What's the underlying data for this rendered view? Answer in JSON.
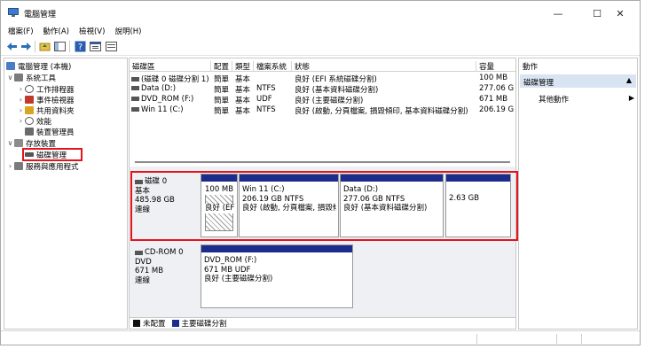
{
  "window": {
    "title": "電腦管理"
  },
  "window_buttons": {
    "minimize": "—",
    "maximize": "☐",
    "close": "✕"
  },
  "menu": [
    "檔案(F)",
    "動作(A)",
    "檢視(V)",
    "說明(H)"
  ],
  "tree": {
    "root": "電腦管理 (本機)",
    "system_tools": "系統工具",
    "task_scheduler": "工作排程器",
    "event_viewer": "事件檢視器",
    "shared_folders": "共用資料夾",
    "performance": "效能",
    "device_manager": "裝置管理員",
    "storage": "存放裝置",
    "disk_management": "磁碟管理",
    "services": "服務與應用程式"
  },
  "volume_table": {
    "headers": [
      "磁碟區",
      "配置",
      "類型",
      "檔案系統",
      "狀態",
      "容量"
    ],
    "rows": [
      {
        "volume": "(磁碟 0 磁碟分割 1)",
        "layout": "簡單",
        "type": "基本",
        "fs": "",
        "status": "良好 (EFI 系統磁碟分割)",
        "capacity": "100 MB"
      },
      {
        "volume": "Data (D:)",
        "layout": "簡單",
        "type": "基本",
        "fs": "NTFS",
        "status": "良好 (基本資料磁碟分割)",
        "capacity": "277.06 G"
      },
      {
        "volume": "DVD_ROM (F:)",
        "layout": "簡單",
        "type": "基本",
        "fs": "UDF",
        "status": "良好 (主要磁碟分割)",
        "capacity": "671 MB"
      },
      {
        "volume": "Win 11 (C:)",
        "layout": "簡單",
        "type": "基本",
        "fs": "NTFS",
        "status": "良好 (啟動, 分頁檔案, 損毀傾印, 基本資料磁碟分割)",
        "capacity": "206.19 G"
      }
    ]
  },
  "disks": {
    "disk0": {
      "name": "磁碟 0",
      "type": "基本",
      "size": "485.98 GB",
      "status": "連線",
      "partitions": [
        {
          "l1": "100 MB",
          "l2": "良好 (EF",
          "l3": ""
        },
        {
          "l1": "Win 11  (C:)",
          "l2": "206.19 GB NTFS",
          "l3": "良好 (啟動, 分頁檔案, 損毀傾"
        },
        {
          "l1": "Data  (D:)",
          "l2": "277.06 GB NTFS",
          "l3": "良好 (基本資料磁碟分割)"
        },
        {
          "l1": "2.63 GB",
          "l2": "",
          "l3": ""
        }
      ]
    },
    "cdrom0": {
      "name": "CD-ROM 0",
      "type": "DVD",
      "size": "671 MB",
      "status": "連線",
      "partition": {
        "l1": "DVD_ROM  (F:)",
        "l2": "671 MB UDF",
        "l3": "良好 (主要磁碟分割)"
      }
    }
  },
  "legend": {
    "unallocated": "未配置",
    "primary": "主要磁碟分割"
  },
  "actions": {
    "header": "動作",
    "section": "磁碟管理",
    "more": "其他動作"
  },
  "colors": {
    "primary_partition": "#1c2c8b",
    "unallocated": "#111111",
    "highlight": "#e4141c",
    "selected": "#d9e4f2"
  }
}
